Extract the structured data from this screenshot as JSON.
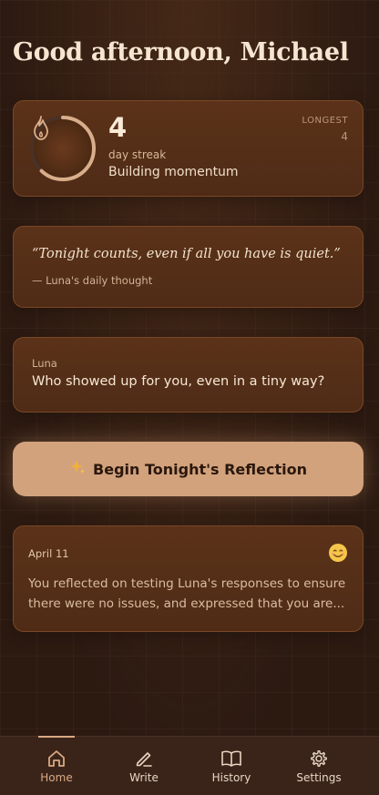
{
  "greeting": "Good afternoon, Michael",
  "streak": {
    "count": "4",
    "unit": "day streak",
    "message": "Building momentum",
    "longest_label": "LONGEST",
    "longest_value": "4",
    "ring_progress": 0.62
  },
  "daily_thought": {
    "quote": "“Tonight counts, even if all you have is quiet.”",
    "attribution": "— Luna's daily thought"
  },
  "prompt": {
    "author": "Luna",
    "question": "Who showed up for you, even in a tiny way?"
  },
  "begin_button": {
    "icon": "sparkles-icon",
    "label": "Begin Tonight's Reflection"
  },
  "recent_entry": {
    "date": "April 11",
    "mood_icon": "smiling-face-icon",
    "summary": "You reflected on testing Luna's responses to ensure there were no issues, and expressed that you are..."
  },
  "tabs": [
    {
      "label": "Home",
      "icon": "home-icon",
      "active": true
    },
    {
      "label": "Write",
      "icon": "pen-icon",
      "active": false
    },
    {
      "label": "History",
      "icon": "book-icon",
      "active": false
    },
    {
      "label": "Settings",
      "icon": "gear-icon",
      "active": false
    }
  ],
  "colors": {
    "background": "#2c1a11",
    "card": "#55301a",
    "accent": "#d2a27c",
    "active_tab": "#d9a983"
  }
}
